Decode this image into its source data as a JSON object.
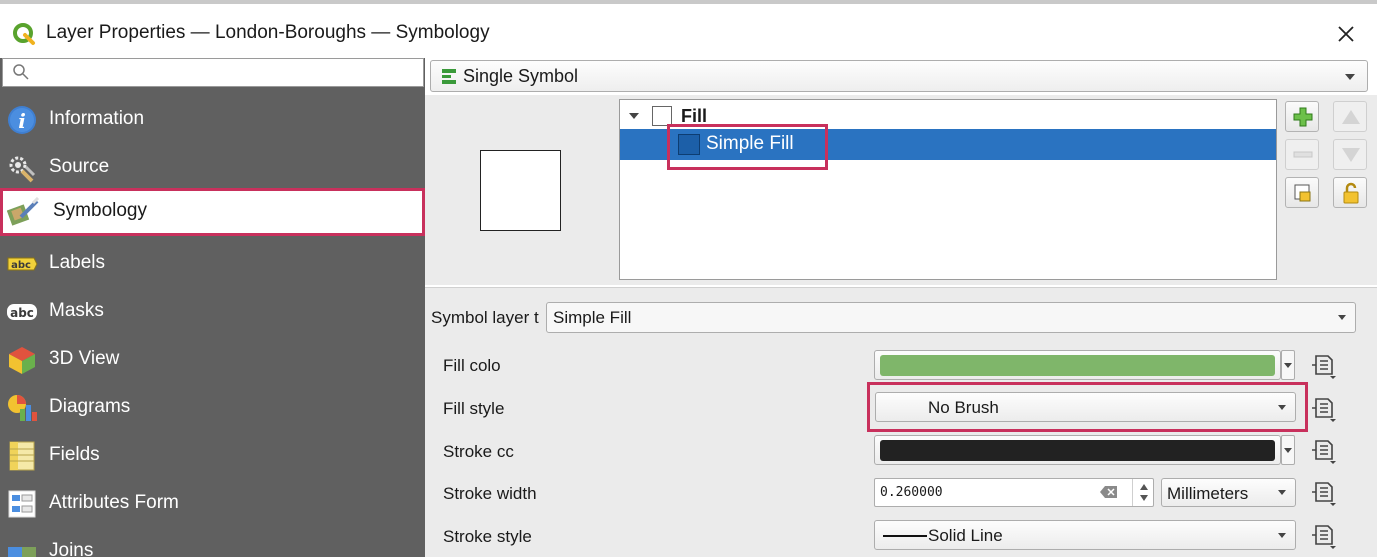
{
  "window": {
    "title": "Layer Properties — London-Boroughs — Symbology",
    "close_icon": "close-icon"
  },
  "sidebar": {
    "search_placeholder": "",
    "items": [
      {
        "label": "Information",
        "icon": "info-icon"
      },
      {
        "label": "Source",
        "icon": "source-icon"
      },
      {
        "label": "Symbology",
        "icon": "symbology-icon",
        "active": true
      },
      {
        "label": "Labels",
        "icon": "labels-icon"
      },
      {
        "label": "Masks",
        "icon": "masks-icon"
      },
      {
        "label": "3D View",
        "icon": "3d-view-icon"
      },
      {
        "label": "Diagrams",
        "icon": "diagrams-icon"
      },
      {
        "label": "Fields",
        "icon": "fields-icon"
      },
      {
        "label": "Attributes Form",
        "icon": "attributes-form-icon"
      },
      {
        "label": "Joins",
        "icon": "joins-icon"
      }
    ]
  },
  "renderer": {
    "selected": "Single Symbol"
  },
  "symbol_tree": {
    "root_label": "Fill",
    "layer_label": "Simple Fill"
  },
  "symbol_layer_type": {
    "label": "Symbol layer t",
    "value": "Simple Fill"
  },
  "properties": {
    "fill_color_label": "Fill colo",
    "fill_color_value": "#7fb66a",
    "fill_style_label": "Fill style",
    "fill_style_value": "No Brush",
    "stroke_color_label": "Stroke cc",
    "stroke_color_value": "#222222",
    "stroke_width_label": "Stroke width",
    "stroke_width_value": "0.260000",
    "stroke_width_unit": "Millimeters",
    "stroke_style_label": "Stroke style",
    "stroke_style_value": "Solid Line"
  },
  "colors": {
    "sidebar_bg": "#606060",
    "selection_blue": "#2a73c1",
    "highlight_border": "#c8305c"
  }
}
